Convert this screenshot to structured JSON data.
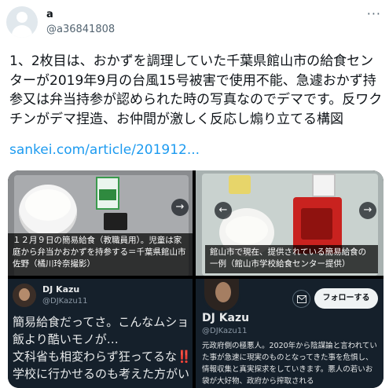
{
  "tweet": {
    "user_name": "a",
    "handle": "@a36841808",
    "more_label": "···",
    "text": "1、2枚目は、おかずを調理していた千葉県館山市の給食センターが2019年9月の台風15号被害で使用不能、急遽おかず持参又は弁当持参が認められた時の写真なのでデマです。反ワクチンがデマ捏造、お仲間が激しく反応し煽り立てる構図",
    "link": "sankei.com/article/201912..."
  },
  "media": {
    "photo1_caption": "１２月９日の簡易給食（教職員用）。児童は家庭から弁当かおかずを持参する＝千葉県館山市佐野（橘川玲奈撮影）",
    "photo1_arrow": "→",
    "photo2_caption": "館山市で現在、提供されている簡易給食の一例（館山市学校給食センター提供）",
    "photo2_arrow_left": "←",
    "photo2_arrow_right": "→",
    "embed_tweet": {
      "name": "DJ Kazu",
      "handle": "@DJKazu11",
      "text": "簡易給食だってさ。こんなムショ飯より酷いモノが…\n文科省も相変わらず狂ってるな‼️\n学校に行かせるのも考えた方がい"
    },
    "embed_profile": {
      "name": "DJ Kazu",
      "handle": "@DJKazu11",
      "follow_label": "フォローする",
      "bio": "元政府側の極悪人。2020年から陰謀論と言われていた事が急速に現実のものとなってきた事を危惧し、情報収集と真実探求をしていきます。悪人の若いお袋が大好物、政府から搾取される"
    }
  }
}
